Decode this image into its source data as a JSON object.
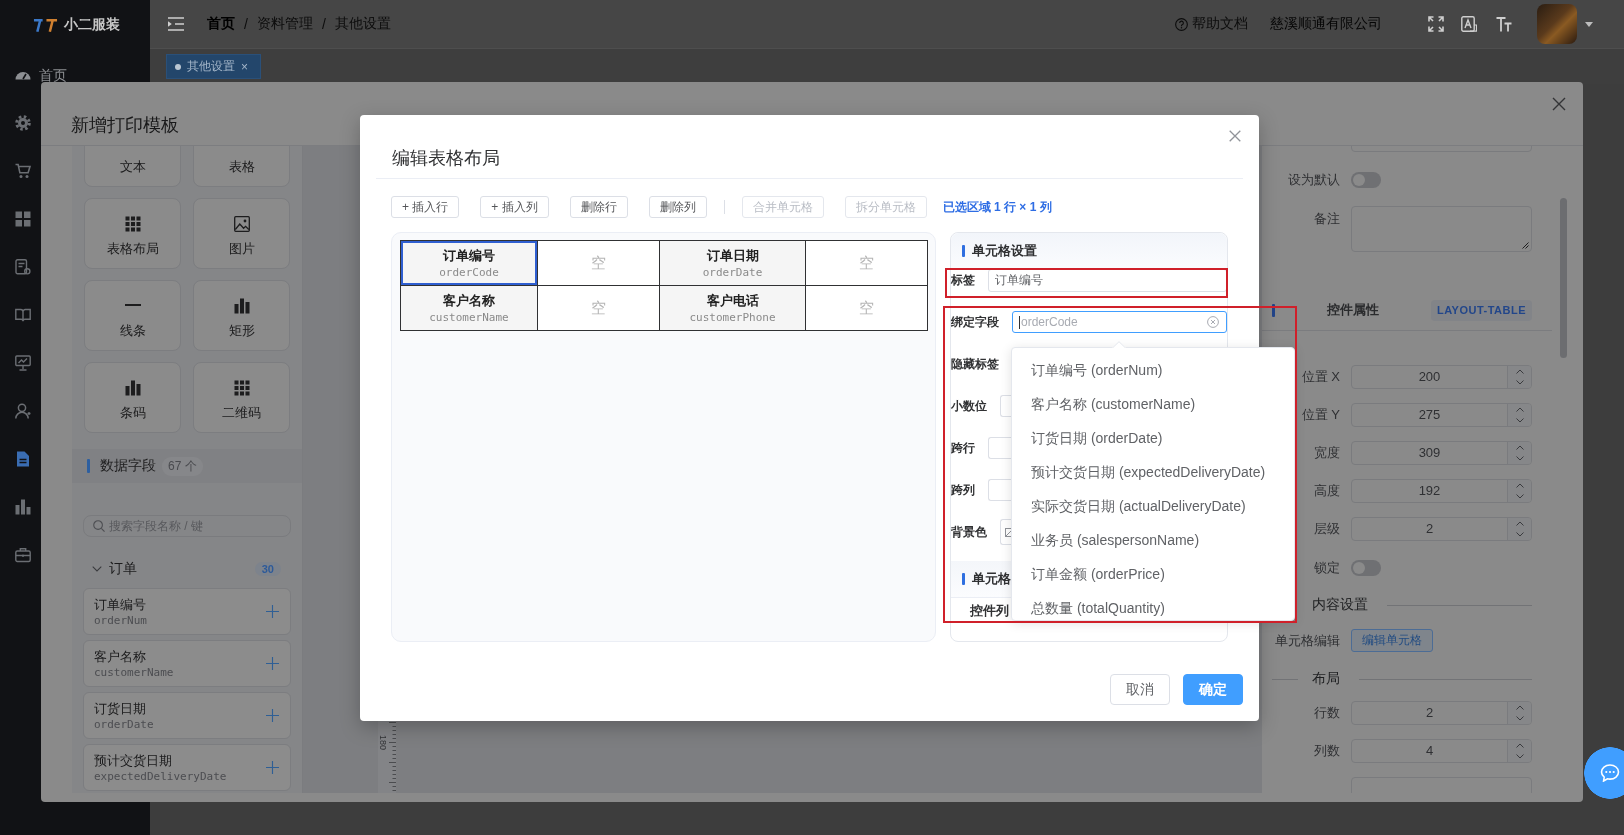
{
  "shell": {
    "logo": "小二服装"
  },
  "sidebar": {
    "items": [
      {
        "label": "首页",
        "selected": false
      },
      {
        "selected": false
      },
      {
        "selected": false
      },
      {
        "selected": false
      },
      {
        "selected": false
      },
      {
        "selected": false
      },
      {
        "selected": false
      },
      {
        "selected": false
      },
      {
        "selected": true
      },
      {
        "selected": false
      },
      {
        "selected": false
      }
    ]
  },
  "header": {
    "breadcrumb": [
      {
        "label": "首页",
        "separator": "/"
      },
      {
        "label": "资料管理",
        "separator": "/"
      },
      {
        "label": "其他设置"
      }
    ],
    "help": "帮助文档",
    "company": "慈溪顺通有限公司"
  },
  "tags": [
    {
      "label": "其他设置",
      "close": "×",
      "selected": true
    }
  ],
  "template_dialog": {
    "title": "新增打印模板",
    "palette": [
      {
        "kind": "text",
        "label": "文本"
      },
      {
        "kind": "table",
        "label": "表格"
      },
      {
        "kind": "layout_table",
        "label": "表格布局"
      },
      {
        "kind": "image",
        "label": "图片"
      },
      {
        "kind": "line",
        "label": "线条"
      },
      {
        "kind": "rect",
        "label": "矩形"
      },
      {
        "kind": "barcode",
        "label": "条码"
      },
      {
        "kind": "qrcode",
        "label": "二维码"
      }
    ],
    "fields_panel": {
      "title": "数据字段",
      "count": "67 个",
      "search": {
        "placeholder": "搜索字段名称 / 键"
      },
      "groups": [
        {
          "label": "订单",
          "count": "30",
          "expanded": true,
          "fields": [
            {
              "label": "订单编号",
              "key": "orderNum"
            },
            {
              "label": "客户名称",
              "key": "customerName"
            },
            {
              "label": "订货日期",
              "key": "orderDate"
            },
            {
              "label": "预计交货日期",
              "key": "expectedDeliveryDate"
            }
          ]
        }
      ]
    },
    "ruler": {
      "label": "180"
    },
    "properties": {
      "default_switch": {
        "label": "设为默认",
        "on": false
      },
      "remark": {
        "label": "备注"
      },
      "section": {
        "title": "控件属性",
        "badge": "LAYOUT-TABLE"
      },
      "position": [
        {
          "label": "位置 X",
          "value": "200"
        },
        {
          "label": "位置 Y",
          "value": "275"
        },
        {
          "label": "宽度",
          "value": "309"
        },
        {
          "label": "高度",
          "value": "192"
        },
        {
          "label": "层级",
          "value": "2"
        }
      ],
      "lock_switch": {
        "label": "锁定",
        "on": false
      },
      "content_heading": "内容设置",
      "cell_edit": {
        "label": "单元格编辑",
        "button": "编辑单元格"
      },
      "layout_heading": "布局",
      "layout": [
        {
          "label": "行数",
          "value": "2"
        },
        {
          "label": "列数",
          "value": "4"
        }
      ]
    }
  },
  "table_dialog": {
    "title": "编辑表格布局",
    "toolbar_groups": [
      [
        {
          "label": "+ 插入行",
          "disabled": false
        },
        {
          "label": "+ 插入列",
          "disabled": false
        },
        {
          "label": "删除行",
          "disabled": false
        },
        {
          "label": "删除列",
          "disabled": false
        }
      ],
      [
        {
          "label": "合并单元格",
          "disabled": true
        },
        {
          "label": "拆分单元格",
          "disabled": true
        }
      ]
    ],
    "selection_info": "已选区域 1 行 × 1 列",
    "grid": [
      [
        {
          "kind": "field",
          "label": "订单编号",
          "key": "orderCode",
          "selected": true
        },
        {
          "kind": "empty",
          "text": "空",
          "selected": false
        },
        {
          "kind": "field",
          "label": "订单日期",
          "key": "orderDate",
          "selected": false
        },
        {
          "kind": "empty",
          "text": "空",
          "selected": false
        }
      ],
      [
        {
          "kind": "field",
          "label": "客户名称",
          "key": "customerName",
          "selected": false
        },
        {
          "kind": "empty",
          "text": "空",
          "selected": false
        },
        {
          "kind": "field",
          "label": "客户电话",
          "key": "customerPhone",
          "selected": false
        },
        {
          "kind": "empty",
          "text": "空",
          "selected": false
        }
      ]
    ],
    "cell_settings": {
      "title": "单元格设置",
      "label_field": {
        "label": "标签",
        "value": "订单编号",
        "highlighted": true
      },
      "bind_field": {
        "label": "绑定字段",
        "placeholder": "orderCode",
        "focused": true,
        "expanded": true,
        "highlighted": true,
        "options": [
          {
            "label": "订单编号 (orderNum)",
            "selected": false
          },
          {
            "label": "客户名称 (customerName)",
            "selected": false
          },
          {
            "label": "订货日期 (orderDate)",
            "selected": false
          },
          {
            "label": "预计交货日期 (expectedDeliveryDate)",
            "selected": false
          },
          {
            "label": "实际交货日期 (actualDeliveryDate)",
            "selected": false
          },
          {
            "label": "业务员 (salespersonName)",
            "selected": false
          },
          {
            "label": "订单金额 (orderPrice)",
            "selected": false
          },
          {
            "label": "总数量 (totalQuantity)",
            "selected": false
          }
        ]
      },
      "rows": [
        {
          "kind": "plain",
          "label": "隐藏标签"
        },
        {
          "kind": "number",
          "label": "小数位"
        },
        {
          "kind": "number",
          "label": "跨行"
        },
        {
          "kind": "number",
          "label": "跨列"
        },
        {
          "kind": "color",
          "label": "背景色"
        }
      ],
      "sub_title": "单元格",
      "list_header": "控件列"
    },
    "buttons": [
      {
        "label": "取消",
        "kind": "default"
      },
      {
        "label": "确定",
        "kind": "primary"
      }
    ]
  }
}
